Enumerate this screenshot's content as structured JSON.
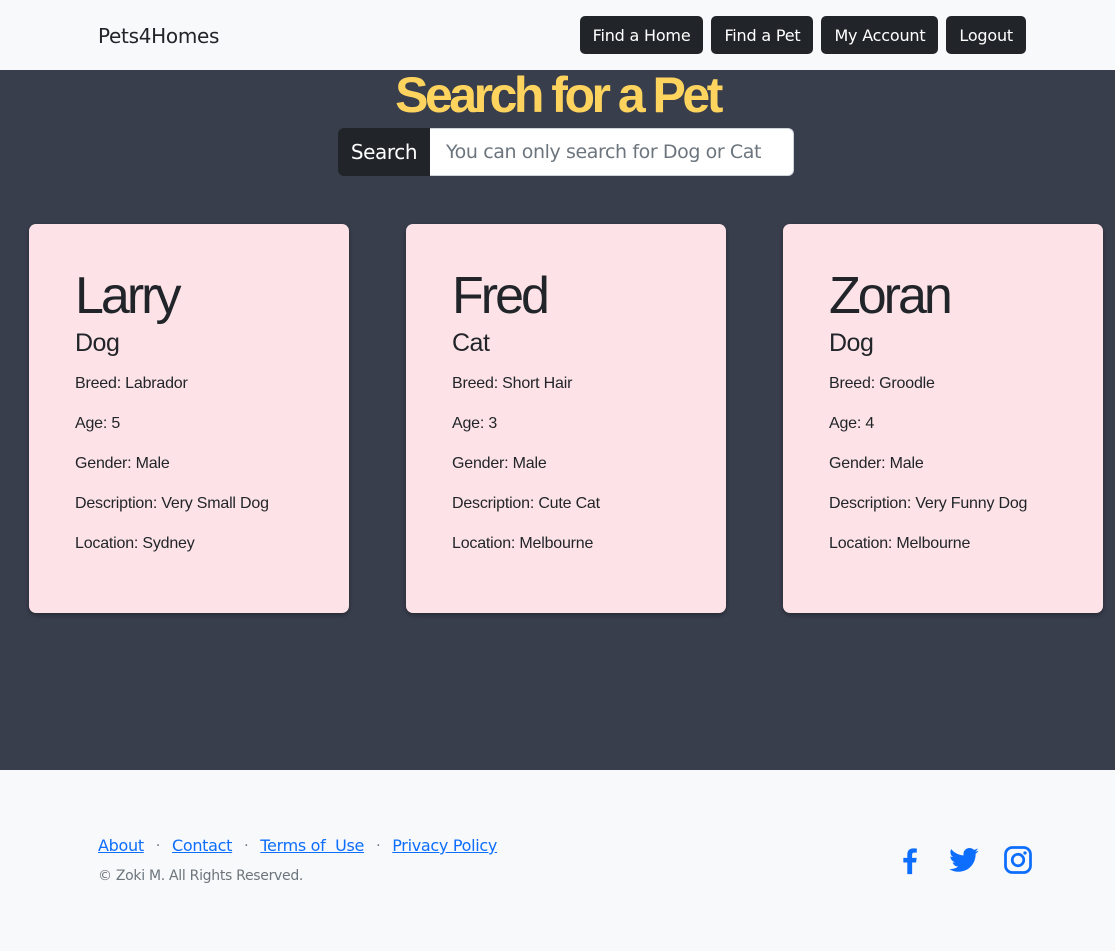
{
  "navbar": {
    "brand": "Pets4Homes",
    "buttons": [
      "Find a Home",
      "Find a Pet",
      "My Account",
      "Logout"
    ]
  },
  "main": {
    "title": "Search for a Pet",
    "search_label": "Search",
    "search_placeholder": "You can only search for Dog or Cat"
  },
  "pets": [
    {
      "name": "Larry",
      "type": "Dog",
      "breed": "Breed: Labrador",
      "age": "Age: 5",
      "gender": "Gender: Male",
      "description": "Description: Very Small Dog",
      "location": "Location: Sydney"
    },
    {
      "name": "Fred",
      "type": "Cat",
      "breed": "Breed: Short Hair",
      "age": "Age: 3",
      "gender": "Gender: Male",
      "description": "Description: Cute Cat",
      "location": "Location: Melbourne"
    },
    {
      "name": "Zoran",
      "type": "Dog",
      "breed": "Breed: Groodle",
      "age": "Age: 4",
      "gender": "Gender: Male",
      "description": "Description: Very Funny Dog",
      "location": "Location: Melbourne"
    }
  ],
  "footer": {
    "links": [
      "About",
      "Contact",
      "Terms of  Use",
      "Privacy Policy"
    ],
    "separator": "·",
    "copyright": "© Zoki M. All Rights Reserved.",
    "social_icons": [
      "facebook-icon",
      "twitter-icon",
      "instagram-icon"
    ]
  },
  "colors": {
    "background": "#393e4d",
    "title": "#ffd45e",
    "card": "#fde3e8",
    "button": "#212529",
    "link": "#0d6efd"
  }
}
